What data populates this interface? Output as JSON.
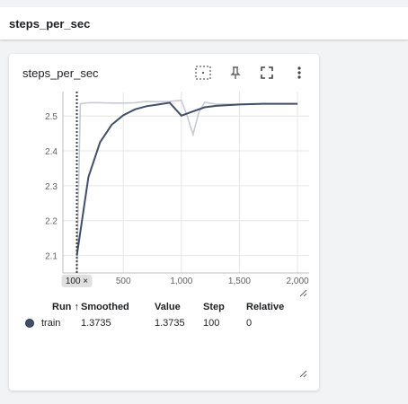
{
  "header": {
    "title": "steps_per_sec"
  },
  "card": {
    "title": "steps_per_sec",
    "toolbar": [
      "fit-domain-icon",
      "pin-icon",
      "fullscreen-icon",
      "more-vert-icon"
    ]
  },
  "chart_data": {
    "type": "line",
    "title": "steps_per_sec",
    "xlabel": "",
    "ylabel": "",
    "xlim": [
      -20,
      2100
    ],
    "ylim": [
      2.05,
      2.57
    ],
    "x_ticks": [
      "500",
      "1,000",
      "1,500",
      "2,000"
    ],
    "x_tick_values": [
      500,
      1000,
      1500,
      2000
    ],
    "y_ticks": [
      "2.1",
      "2.2",
      "2.3",
      "2.4",
      "2.5"
    ],
    "y_tick_values": [
      2.1,
      2.2,
      2.3,
      2.4,
      2.5
    ],
    "cursor_step": 100,
    "cursor_label": "100 ×",
    "grid": true,
    "series": [
      {
        "name": "train",
        "role": "smoothed",
        "color": "#404e68",
        "x": [
          100,
          200,
          300,
          400,
          500,
          600,
          700,
          800,
          900,
          1000,
          1100,
          1200,
          1300,
          1400,
          1500,
          1600,
          1700,
          1800,
          1900,
          2000
        ],
        "y": [
          2.1,
          2.325,
          2.425,
          2.475,
          2.502,
          2.519,
          2.528,
          2.533,
          2.538,
          2.501,
          2.513,
          2.525,
          2.529,
          2.531,
          2.533,
          2.534,
          2.535,
          2.535,
          2.535,
          2.535
        ]
      },
      {
        "name": "train",
        "role": "raw",
        "color": "#c6cbd4",
        "x": [
          100,
          130,
          200,
          300,
          400,
          500,
          600,
          700,
          800,
          900,
          1000,
          1050,
          1100,
          1150,
          1200,
          1300,
          1400,
          1500,
          1600,
          1700,
          1800,
          1900,
          2000
        ],
        "y": [
          2.05,
          2.535,
          2.538,
          2.538,
          2.537,
          2.537,
          2.538,
          2.542,
          2.541,
          2.542,
          2.545,
          2.5,
          2.447,
          2.51,
          2.539,
          2.534,
          2.534,
          2.534,
          2.535,
          2.535,
          2.535,
          2.535,
          2.535
        ]
      }
    ]
  },
  "table": {
    "headers": {
      "run": "Run ↑",
      "smoothed": "Smoothed",
      "value": "Value",
      "step": "Step",
      "relative": "Relative"
    },
    "rows": [
      {
        "run": "train",
        "smoothed": "1.3735",
        "value": "1.3735",
        "step": "100",
        "relative": "0",
        "color": "#404e68"
      }
    ]
  }
}
